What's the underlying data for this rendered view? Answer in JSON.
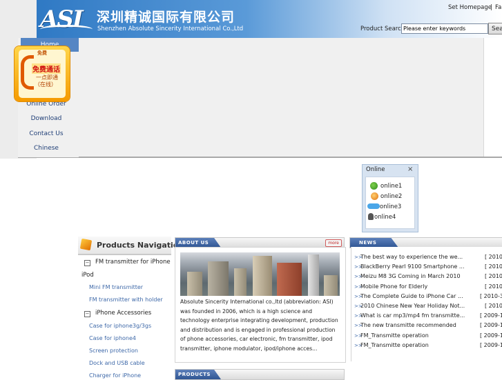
{
  "header": {
    "logo_text": "ASI",
    "company_cn": "深圳精诚国际有限公司",
    "company_en": "Shenzhen Absolute Sincerity International Co.,Ltd",
    "set_homepage": "Set Homepage",
    "separator": "|",
    "favorites": "Fa",
    "search_label": "Product Search",
    "search_placeholder": "Please enter keywords",
    "search_button": "Sea"
  },
  "nav": {
    "items": [
      "Home",
      "Online Order",
      "Download",
      "Contact Us",
      "Chinese"
    ]
  },
  "phone_widget": {
    "brand": "免费",
    "free_call": "免费通话",
    "line1": "一点即通",
    "line2": "（在线）"
  },
  "online_widget": {
    "title": "Online",
    "close": "×",
    "items": [
      "online1",
      "online2",
      "online3",
      "online4"
    ]
  },
  "products_nav": {
    "title": "Products Navigation",
    "items": [
      {
        "label": "FM transmitter for iPhone",
        "type": "main"
      },
      {
        "label": "iPod",
        "type": "cont"
      },
      {
        "label": "Mini FM transmitter",
        "type": "sub"
      },
      {
        "label": "FM transmitter with holder",
        "type": "sub"
      },
      {
        "label": "iPhone Accessories",
        "type": "main"
      },
      {
        "label": "Case for iphone3g/3gs",
        "type": "sub"
      },
      {
        "label": "Case for iphone4",
        "type": "sub"
      },
      {
        "label": "Screen protection",
        "type": "sub"
      },
      {
        "label": "Dock and USB cable",
        "type": "sub"
      },
      {
        "label": "Charger for iPhone",
        "type": "sub"
      }
    ]
  },
  "about": {
    "tab_label": "ABOUT US",
    "more": "more",
    "text": "Absolute Sincerity International co.,ltd (abbreviation: ASI) was founded in 2006, which is a high science and technology enterprise integrating development, production and distribution and is engaged in professional production of phone accessories, car electronic, fm transmitter, ipod transmitter, iphone modulator, ipod/iphone acces..."
  },
  "news": {
    "tab_label": "NEWS",
    "items": [
      {
        "title": "The best way to experience the we...",
        "date": "[ 2010-"
      },
      {
        "title": "BlackBerry Pearl 9100 Smartphone ...",
        "date": "[ 2010-"
      },
      {
        "title": "Meizu M8 3G Coming in March 2010",
        "date": "[ 2010-"
      },
      {
        "title": "Mobile Phone for Elderly",
        "date": "[ 2010-"
      },
      {
        "title": "The Complete Guide to iPhone Car ...",
        "date": "[ 2010-3"
      },
      {
        "title": "2010 Chinese New Year Holiday Not...",
        "date": "[ 2010-"
      },
      {
        "title": "What is car mp3/mp4 fm transmitte...",
        "date": "[ 2009-11"
      },
      {
        "title": "The new transmitte recommended",
        "date": "[ 2009-10"
      },
      {
        "title": "FM_Transmitte operation",
        "date": "[ 2009-10"
      },
      {
        "title": "FM_Transmitte operation",
        "date": "[ 2009-10"
      }
    ]
  },
  "products": {
    "tab_label": "PRODUCTS"
  }
}
